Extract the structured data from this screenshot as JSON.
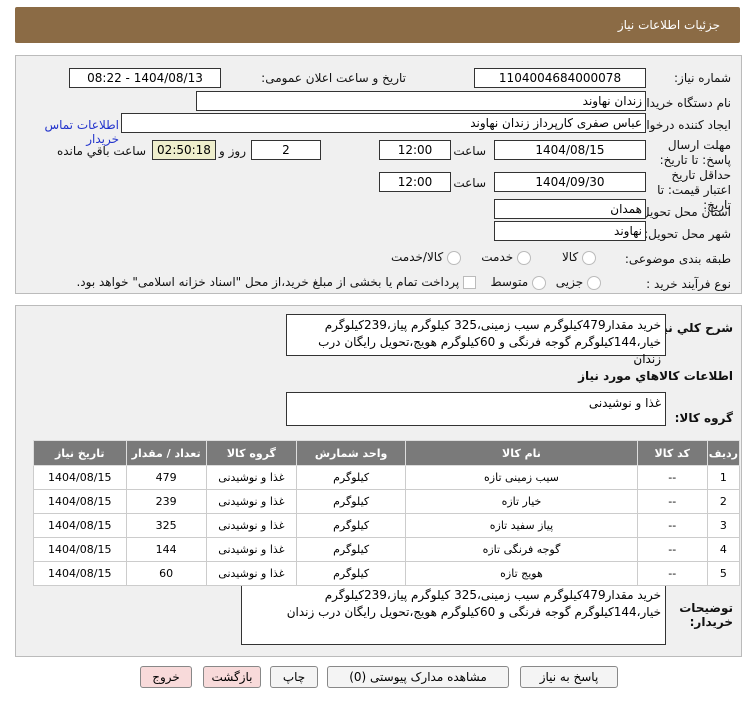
{
  "header": {
    "title": "جزئیات اطلاعات نیاز"
  },
  "form": {
    "need_no_label": "شماره نیاز:",
    "need_no": "1104004684000078",
    "announce_label": "تاریخ و ساعت اعلان عمومی:",
    "announce": "1404/08/13 - 08:22",
    "buyer_label": "نام دستگاه خریدار:",
    "buyer": "زندان نهاوند",
    "creator_label": "ایجاد کننده درخواست:",
    "creator": "عباس صفری کارپرداز زندان نهاوند",
    "contact_link": "اطلاعات تماس خریدار",
    "deadline_label": "مهلت ارسال پاسخ: تا تاریخ:",
    "deadline_date": "1404/08/15",
    "time_label": "ساعت",
    "deadline_time": "12:00",
    "days": "2",
    "days_label": "روز و",
    "remaining": "02:50:18",
    "remaining_label": "ساعت باقي مانده",
    "validity_label": "حداقل تاریخ اعتبار قیمت: تا تاریخ:",
    "validity_date": "1404/09/30",
    "validity_time": "12:00",
    "province_label": "استان محل تحویل:",
    "province": "همدان",
    "city_label": "شهر محل تحویل:",
    "city": "نهاوند",
    "category_label": "طبقه بندی موضوعی:",
    "cat_options": [
      "کالا",
      "خدمت",
      "کالا/خدمت"
    ],
    "process_label": "نوع فرآیند خرید :",
    "process_options": [
      "جزیی",
      "متوسط"
    ],
    "payment_note": "پرداخت تمام یا بخشی از مبلغ خرید،از محل \"اسناد خزانه اسلامی\" خواهد بود."
  },
  "desc": {
    "label": "شرح کلي نياز:",
    "text": "خرید مقدار479کیلوگرم سیب زمینی،325 کیلوگرم پیاز،239کیلوگرم خیار،144کیلوگرم گوجه فرنگی و 60کیلوگرم هویج،تحویل رایگان درب زندان",
    "goods_title": "اطلاعات کالاهاي مورد نياز",
    "group_label": "گروه کالا:",
    "group": "غذا و نوشیدنی"
  },
  "table": {
    "headers": [
      "ردیف",
      "کد کالا",
      "نام کالا",
      "واحد شمارش",
      "گروه کالا",
      "تعداد / مقدار",
      "تاریخ نیاز"
    ],
    "rows": [
      [
        "1",
        "--",
        "سیب زمینی تازه",
        "کیلوگرم",
        "غذا و نوشیدنی",
        "479",
        "1404/08/15"
      ],
      [
        "2",
        "--",
        "خیار تازه",
        "کیلوگرم",
        "غذا و نوشیدنی",
        "239",
        "1404/08/15"
      ],
      [
        "3",
        "--",
        "پیاز سفید تازه",
        "کیلوگرم",
        "غذا و نوشیدنی",
        "325",
        "1404/08/15"
      ],
      [
        "4",
        "--",
        "گوجه فرنگی تازه",
        "کیلوگرم",
        "غذا و نوشیدنی",
        "144",
        "1404/08/15"
      ],
      [
        "5",
        "--",
        "هویج تازه",
        "کیلوگرم",
        "غذا و نوشیدنی",
        "60",
        "1404/08/15"
      ]
    ]
  },
  "notes": {
    "label": "توضیحات خریدار:",
    "text": "خرید مقدار479کیلوگرم سیب زمینی،325 کیلوگرم پیاز،239کیلوگرم خیار،144کیلوگرم گوجه فرنگی و 60کیلوگرم هویج،تحویل رایگان درب زندان"
  },
  "buttons": {
    "reply": "پاسخ به نیاز",
    "docs": "مشاهده مدارک پیوستی (0)",
    "print": "چاپ",
    "back": "بازگشت",
    "exit": "خروج"
  }
}
